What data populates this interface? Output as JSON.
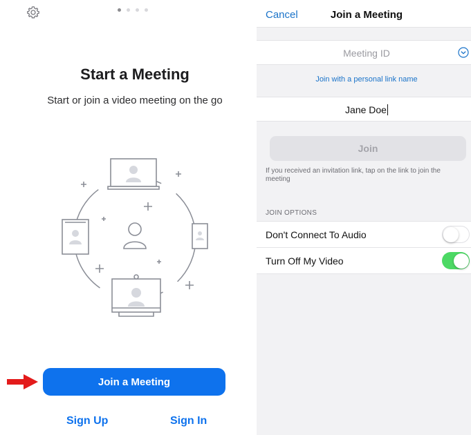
{
  "left": {
    "title": "Start a Meeting",
    "subtitle": "Start or join a video meeting on the go",
    "join_button": "Join a Meeting",
    "sign_up": "Sign Up",
    "sign_in": "Sign In",
    "pagination": {
      "total": 4,
      "active": 1
    }
  },
  "right": {
    "nav": {
      "cancel": "Cancel",
      "title": "Join a Meeting"
    },
    "meeting_id_placeholder": "Meeting ID",
    "personal_link": "Join with a personal link name",
    "name_value": "Jane Doe",
    "join_button": "Join",
    "hint": "If you received an invitation link, tap on the link to join the meeting",
    "options_header": "JOIN OPTIONS",
    "options": [
      {
        "label": "Don't Connect To Audio",
        "enabled": false
      },
      {
        "label": "Turn Off My Video",
        "enabled": true
      }
    ]
  },
  "colors": {
    "primary_blue": "#0e72ed",
    "link_blue": "#1a73c9",
    "toggle_on": "#4cd964",
    "arrow_red": "#e31b1b"
  },
  "icons": [
    "gear-icon",
    "chevron-down-icon",
    "arrow-right-icon",
    "meeting-illustration"
  ]
}
